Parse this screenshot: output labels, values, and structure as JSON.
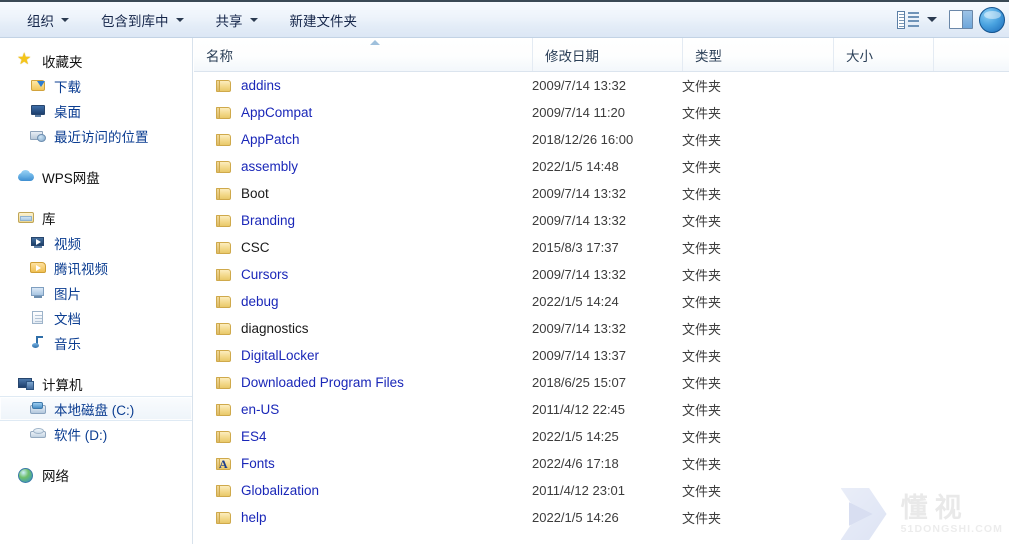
{
  "toolbar": {
    "items": [
      {
        "label": "组织",
        "has_caret": true
      },
      {
        "label": "包含到库中",
        "has_caret": true
      },
      {
        "label": "共享",
        "has_caret": true
      },
      {
        "label": "新建文件夹",
        "has_caret": false
      }
    ],
    "view_mode_icon": "view-mode-icon",
    "preview_pane_icon": "preview-pane-icon",
    "help_icon": "help-icon"
  },
  "sidebar": {
    "groups": [
      {
        "root": {
          "label": "收藏夹",
          "icon": "star-icon"
        },
        "items": [
          {
            "label": "下载",
            "icon": "downloads-icon"
          },
          {
            "label": "桌面",
            "icon": "desktop-icon"
          },
          {
            "label": "最近访问的位置",
            "icon": "recent-places-icon"
          }
        ]
      },
      {
        "root": {
          "label": "WPS网盘",
          "icon": "cloud-icon"
        },
        "items": []
      },
      {
        "root": {
          "label": "库",
          "icon": "library-icon"
        },
        "items": [
          {
            "label": "视频",
            "icon": "videos-icon"
          },
          {
            "label": "腾讯视频",
            "icon": "tencent-video-icon"
          },
          {
            "label": "图片",
            "icon": "pictures-icon"
          },
          {
            "label": "文档",
            "icon": "documents-icon"
          },
          {
            "label": "音乐",
            "icon": "music-icon"
          }
        ]
      },
      {
        "root": {
          "label": "计算机",
          "icon": "computer-icon"
        },
        "items": [
          {
            "label": "本地磁盘 (C:)",
            "icon": "local-disk-icon",
            "selected": true
          },
          {
            "label": "软件 (D:)",
            "icon": "optical-drive-icon"
          }
        ]
      },
      {
        "root": {
          "label": "网络",
          "icon": "network-icon"
        },
        "items": []
      }
    ]
  },
  "columns": [
    {
      "label": "名称",
      "sorted": "asc"
    },
    {
      "label": "修改日期",
      "sorted": ""
    },
    {
      "label": "类型",
      "sorted": ""
    },
    {
      "label": "大小",
      "sorted": ""
    }
  ],
  "files": [
    {
      "name": "addins",
      "date": "2009/7/14 13:32",
      "type": "文件夹",
      "size": "",
      "color": "blue",
      "icon": "folder-icon"
    },
    {
      "name": "AppCompat",
      "date": "2009/7/14 11:20",
      "type": "文件夹",
      "size": "",
      "color": "blue",
      "icon": "folder-icon"
    },
    {
      "name": "AppPatch",
      "date": "2018/12/26 16:00",
      "type": "文件夹",
      "size": "",
      "color": "blue",
      "icon": "folder-icon"
    },
    {
      "name": "assembly",
      "date": "2022/1/5 14:48",
      "type": "文件夹",
      "size": "",
      "color": "blue",
      "icon": "folder-icon"
    },
    {
      "name": "Boot",
      "date": "2009/7/14 13:32",
      "type": "文件夹",
      "size": "",
      "color": "black",
      "icon": "folder-icon"
    },
    {
      "name": "Branding",
      "date": "2009/7/14 13:32",
      "type": "文件夹",
      "size": "",
      "color": "blue",
      "icon": "folder-icon"
    },
    {
      "name": "CSC",
      "date": "2015/8/3 17:37",
      "type": "文件夹",
      "size": "",
      "color": "black",
      "icon": "folder-icon"
    },
    {
      "name": "Cursors",
      "date": "2009/7/14 13:32",
      "type": "文件夹",
      "size": "",
      "color": "blue",
      "icon": "folder-icon"
    },
    {
      "name": "debug",
      "date": "2022/1/5 14:24",
      "type": "文件夹",
      "size": "",
      "color": "blue",
      "icon": "folder-icon"
    },
    {
      "name": "diagnostics",
      "date": "2009/7/14 13:32",
      "type": "文件夹",
      "size": "",
      "color": "black",
      "icon": "folder-icon"
    },
    {
      "name": "DigitalLocker",
      "date": "2009/7/14 13:37",
      "type": "文件夹",
      "size": "",
      "color": "blue",
      "icon": "folder-icon"
    },
    {
      "name": "Downloaded Program Files",
      "date": "2018/6/25 15:07",
      "type": "文件夹",
      "size": "",
      "color": "blue",
      "icon": "folder-icon"
    },
    {
      "name": "en-US",
      "date": "2011/4/12 22:45",
      "type": "文件夹",
      "size": "",
      "color": "blue",
      "icon": "folder-icon"
    },
    {
      "name": "ES4",
      "date": "2022/1/5 14:25",
      "type": "文件夹",
      "size": "",
      "color": "blue",
      "icon": "folder-icon"
    },
    {
      "name": "Fonts",
      "date": "2022/4/6 17:18",
      "type": "文件夹",
      "size": "",
      "color": "blue",
      "icon": "fonts-folder-icon"
    },
    {
      "name": "Globalization",
      "date": "2011/4/12 23:01",
      "type": "文件夹",
      "size": "",
      "color": "blue",
      "icon": "folder-icon"
    },
    {
      "name": "help",
      "date": "2022/1/5 14:26",
      "type": "文件夹",
      "size": "",
      "color": "blue",
      "icon": "folder-icon"
    }
  ],
  "watermark": {
    "cn": "懂视",
    "url": "51DONGSHI.COM"
  }
}
